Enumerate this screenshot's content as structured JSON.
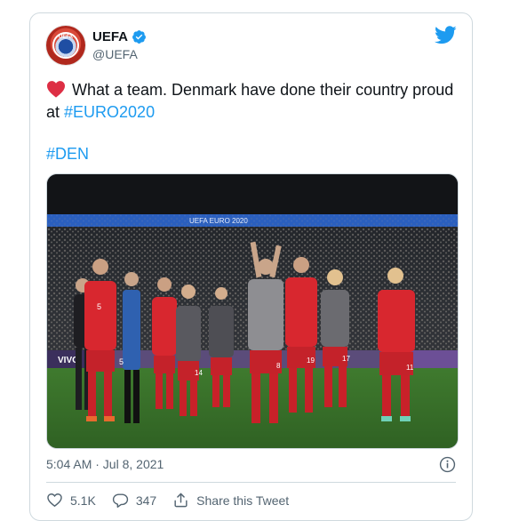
{
  "author": {
    "name": "UEFA",
    "handle": "@UEFA",
    "avatar_text": "UEFA"
  },
  "tweet": {
    "text_part1": "What a team. Denmark have done their country proud at ",
    "hashtag1": "#EURO2020",
    "hashtag2": "#DEN"
  },
  "media": {
    "banner_text": "UEFA EURO 2020",
    "ad_text": "VIVO",
    "jersey_numbers": [
      "5",
      "8",
      "14",
      "19",
      "17",
      "11",
      "5"
    ]
  },
  "meta": {
    "timestamp": "5:04 AM · Jul 8, 2021"
  },
  "actions": {
    "likes": "5.1K",
    "replies": "347",
    "share_label": "Share this Tweet"
  },
  "colors": {
    "accent": "#1d9bf0",
    "heart": "#e0245e",
    "text": "#0f1419",
    "muted": "#536471"
  },
  "icons": [
    "twitter-bird-icon",
    "verified-badge-icon",
    "red-heart-emoji-icon",
    "info-icon",
    "like-heart-icon",
    "reply-bubble-icon",
    "share-icon"
  ]
}
